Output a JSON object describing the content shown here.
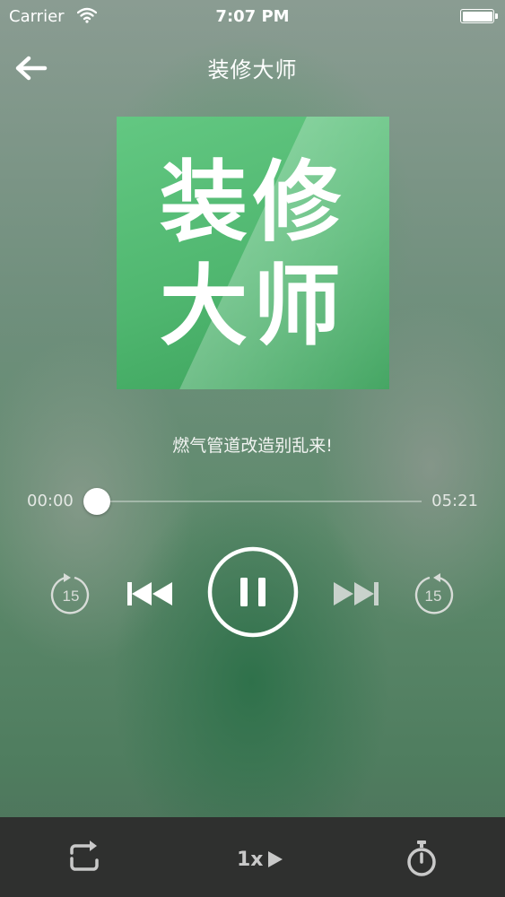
{
  "status_bar": {
    "carrier": "Carrier",
    "time": "7:07 PM"
  },
  "header": {
    "title": "装修大师"
  },
  "cover": {
    "line1": "装修",
    "line2": "大师",
    "color": "#4fb66f"
  },
  "track": {
    "title": "燃气管道改造别乱来!"
  },
  "progress": {
    "current": "00:00",
    "total": "05:21",
    "fraction": 0.0
  },
  "controls": {
    "skip_back_seconds": "15",
    "skip_forward_seconds": "15",
    "play_state": "pause-icon"
  },
  "bottom_bar": {
    "speed_label": "1x"
  }
}
